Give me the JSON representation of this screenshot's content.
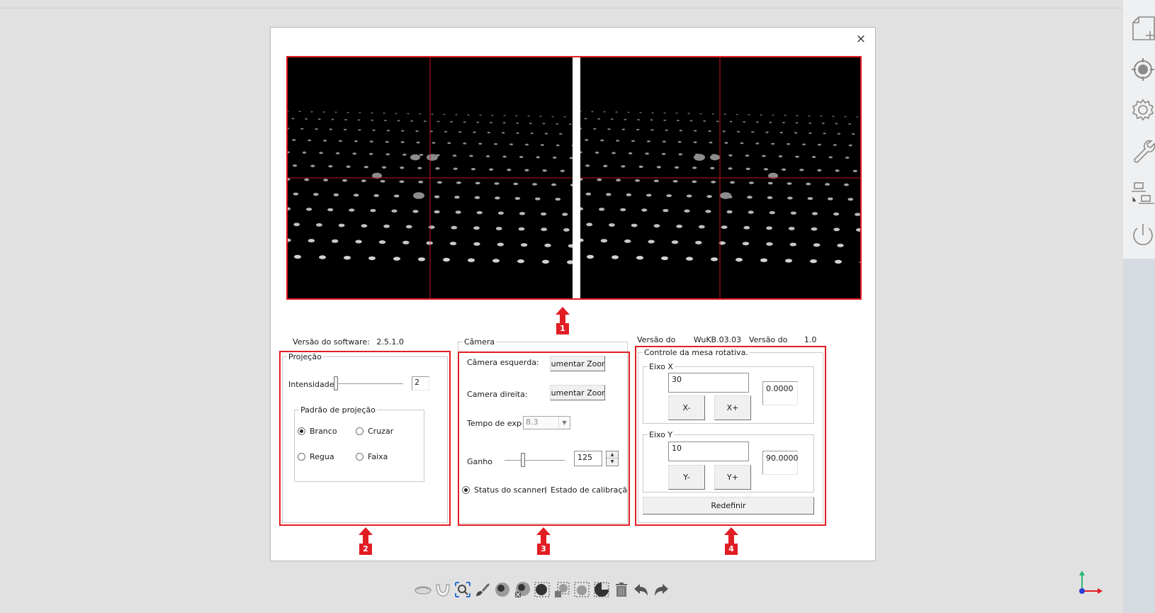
{
  "dialog": {
    "close_label": "×",
    "callouts": [
      "1",
      "2",
      "3",
      "4"
    ]
  },
  "info": {
    "software_version_label": "Versão do software:",
    "software_version_value": "2.5.1.0",
    "firmware_label_1": "Versão do",
    "firmware_value_1": "WuKB.03.03",
    "firmware_label_2": "Versão do",
    "firmware_value_2": "1.0"
  },
  "projection": {
    "legend": "Projeção",
    "intensity_label": "Intensidade",
    "intensity_value": "2",
    "pattern_legend": "Padrão de projeção",
    "patterns": [
      {
        "label": "Branco",
        "selected": true
      },
      {
        "label": "Cruzar",
        "selected": false
      },
      {
        "label": "Regua",
        "selected": false
      },
      {
        "label": "Faixa",
        "selected": false
      }
    ]
  },
  "camera": {
    "legend": "Câmera",
    "left_label": "Câmera esquerda:",
    "left_button": "Aumentar Zoom",
    "right_label": "Camera direita:",
    "right_button": "Aumentar Zoom",
    "exposure_label": "Tempo de exposição",
    "exposure_value": "8.3",
    "gain_label": "Ganho",
    "gain_value": "125",
    "status_options": [
      {
        "label": "Status do scanner",
        "selected": true
      },
      {
        "label": "Estado de calibração",
        "selected": false
      }
    ]
  },
  "turntable": {
    "legend": "Controle da mesa rotativa.",
    "x_axis": {
      "legend": "Eixo X",
      "step_value": "30",
      "position": "0.0000",
      "minus_label": "X-",
      "plus_label": "X+"
    },
    "y_axis": {
      "legend": "Eixo Y",
      "step_value": "10",
      "position": "90.0000",
      "minus_label": "Y-",
      "plus_label": "Y+"
    },
    "reset_label": "Redefinir"
  },
  "toolbar": {
    "icons": [
      "jaw-icon",
      "arch-icon",
      "zoom-select-icon",
      "brush-icon",
      "view-cube-icon",
      "view-cube-x-icon",
      "lasso-icon",
      "lasso-plus-icon",
      "lasso-minus-icon",
      "half-sphere-icon",
      "trash-icon",
      "undo-icon",
      "redo-icon"
    ]
  },
  "sidebar": {
    "icons": [
      "new-file-icon",
      "target-icon",
      "gear-icon",
      "wrench-icon",
      "devices-icon",
      "power-icon"
    ]
  },
  "colors": {
    "accent_red": "#e21d24",
    "dialog_bg": "#ffffff",
    "page_bg": "#e1e1e1",
    "crosshair": "#c1121f"
  }
}
